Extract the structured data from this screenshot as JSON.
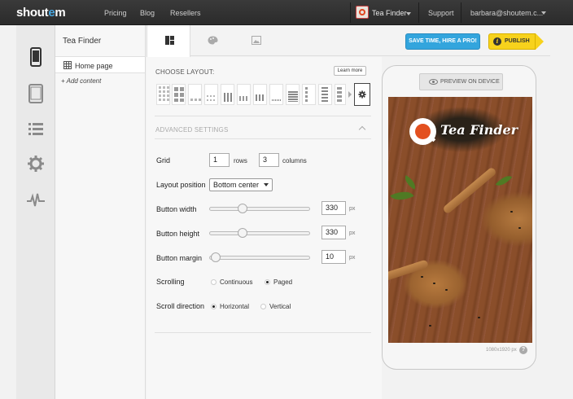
{
  "topbar": {
    "logo_main": "shout",
    "logo_accent": "e",
    "logo_end": "m",
    "nav": [
      "Pricing",
      "Blog",
      "Resellers"
    ],
    "app_selector": "Tea Finder",
    "support": "Support",
    "account": "barbara@shoutem.c..."
  },
  "rail": {
    "icons": [
      "phone-icon",
      "tablet-icon",
      "list-icon",
      "gear-icon",
      "pulse-icon"
    ]
  },
  "pages": {
    "title": "Tea Finder",
    "home": "Home page",
    "add_content": "Add content"
  },
  "tabs": [
    "layout-tab",
    "theme-tab",
    "image-tab"
  ],
  "actions": {
    "hire": "SAVE TIME, HIRE A PRO!",
    "publish": "PUBLISH"
  },
  "layout": {
    "choose_label": "CHOOSE LAYOUT:",
    "learn_more": "Learn more",
    "advanced_label": "ADVANCED SETTINGS"
  },
  "settings": {
    "grid_label": "Grid",
    "grid_rows": "1",
    "rows_unit": "rows",
    "grid_columns": "3",
    "columns_unit": "columns",
    "position_label": "Layout position",
    "position_value": "Bottom center",
    "button_width_label": "Button width",
    "button_width": "330",
    "button_width_level": 0.31,
    "button_height_label": "Button height",
    "button_height": "330",
    "button_height_level": 0.31,
    "button_margin_label": "Button margin",
    "button_margin": "10",
    "button_margin_level": 0.02,
    "px": "px",
    "scrolling_label": "Scrolling",
    "scrolling_opt1": "Continuous",
    "scrolling_opt2": "Paged",
    "scrolling_selected": "Paged",
    "direction_label": "Scroll direction",
    "direction_opt1": "Horizontal",
    "direction_opt2": "Vertical",
    "direction_selected": "Horizontal"
  },
  "preview": {
    "button": "PREVIEW ON DEVICE",
    "brand": "Tea Finder",
    "dims": "1080x1920 px",
    "help": "?"
  },
  "colors": {
    "hire_bg": "#33a5dd",
    "publish_bg": "#f7d21c",
    "brand_orange": "#e3501f"
  }
}
